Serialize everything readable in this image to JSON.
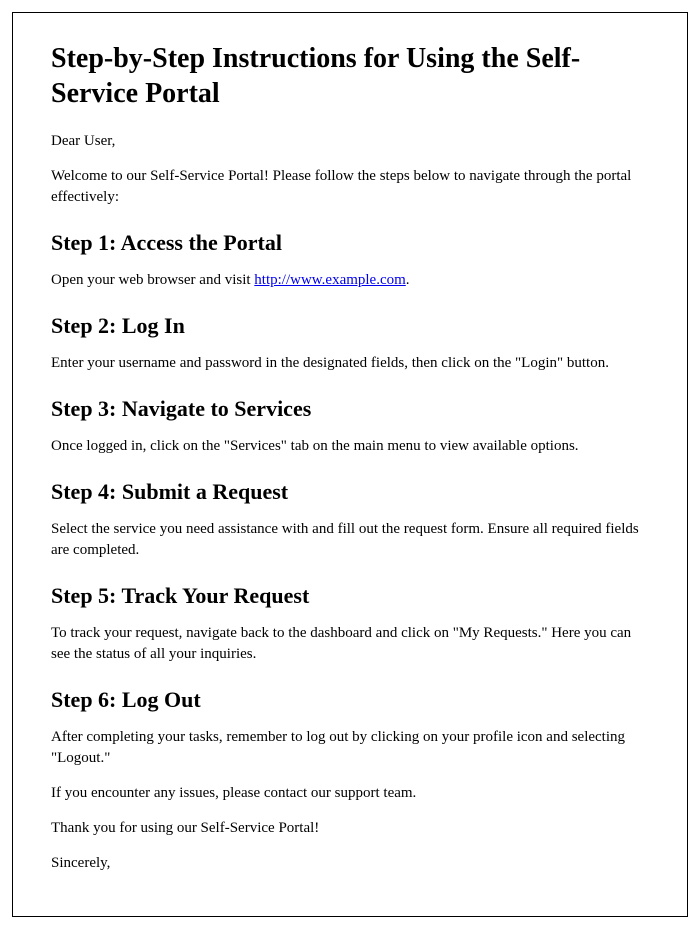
{
  "title": "Step-by-Step Instructions for Using the Self-Service Portal",
  "salutation": "Dear User,",
  "intro": "Welcome to our Self-Service Portal! Please follow the steps below to navigate through the portal effectively:",
  "step1_heading": "Step 1: Access the Portal",
  "step1_text_before": "Open your web browser and visit ",
  "step1_link_text": "http://www.example.com",
  "step1_link_href": "http://www.example.com",
  "step1_text_after": ".",
  "step2_heading": "Step 2: Log In",
  "step2_text": "Enter your username and password in the designated fields, then click on the \"Login\" button.",
  "step3_heading": "Step 3: Navigate to Services",
  "step3_text": "Once logged in, click on the \"Services\" tab on the main menu to view available options.",
  "step4_heading": "Step 4: Submit a Request",
  "step4_text": "Select the service you need assistance with and fill out the request form. Ensure all required fields are completed.",
  "step5_heading": "Step 5: Track Your Request",
  "step5_text": "To track your request, navigate back to the dashboard and click on \"My Requests.\" Here you can see the status of all your inquiries.",
  "step6_heading": "Step 6: Log Out",
  "step6_text": "After completing your tasks, remember to log out by clicking on your profile icon and selecting \"Logout.\"",
  "closing1": "If you encounter any issues, please contact our support team.",
  "closing2": "Thank you for using our Self-Service Portal!",
  "signoff": "Sincerely,"
}
